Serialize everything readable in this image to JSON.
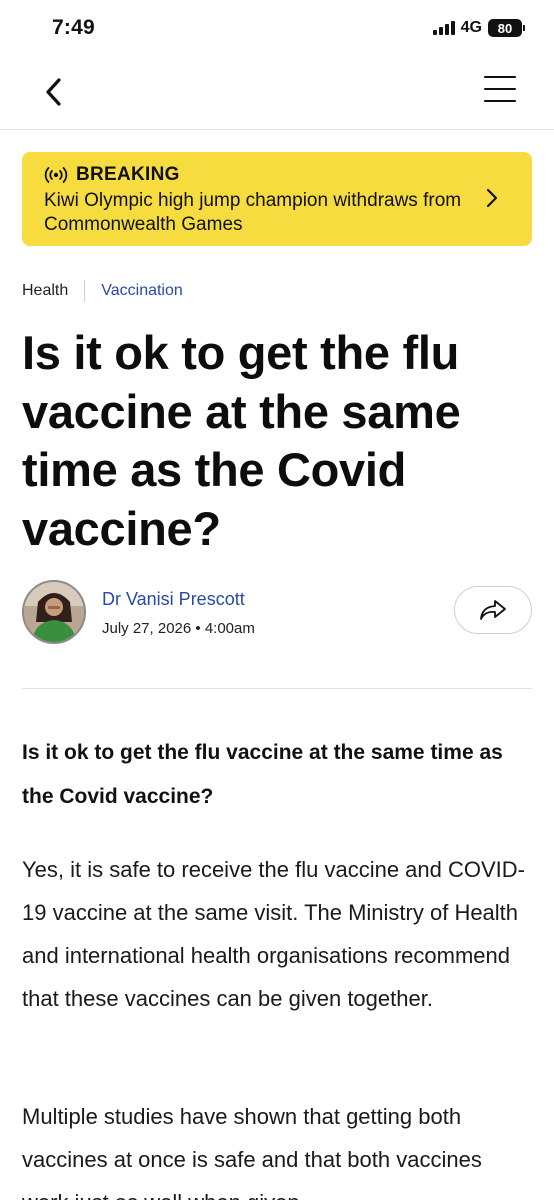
{
  "status": {
    "time": "7:49",
    "network": "4G",
    "battery": "80"
  },
  "breaking": {
    "label": "BREAKING",
    "text": "Kiwi Olympic high jump champion withdraws from Commonwealth Games"
  },
  "categories": {
    "primary": "Health",
    "secondary": "Vaccination"
  },
  "article": {
    "headline": "Is it ok to get the flu vaccine at the same time as the Covid vaccine?",
    "author": "Dr Vanisi Prescott",
    "date": "July 27, 2026 • 4:00am",
    "subhead": "Is it ok to get the flu vaccine at the same time as the Covid vaccine?",
    "paragraphs": [
      "Yes, it is safe to receive the flu vaccine and COVID-19 vaccine at the same visit. The Ministry of Health and international health organisations recommend that these vaccines can be given together.",
      "Multiple studies have shown that getting both vaccines at once is safe and that both vaccines work just as well when given"
    ]
  },
  "icons": {
    "back": "chevron-left-icon",
    "menu": "hamburger-menu-icon",
    "broadcast": "broadcast-icon",
    "breaking_arrow": "chevron-right-icon",
    "share": "share-arrow-icon"
  },
  "colors": {
    "breaking_bg": "#f7dc3f",
    "link_blue": "#2a49a8"
  }
}
